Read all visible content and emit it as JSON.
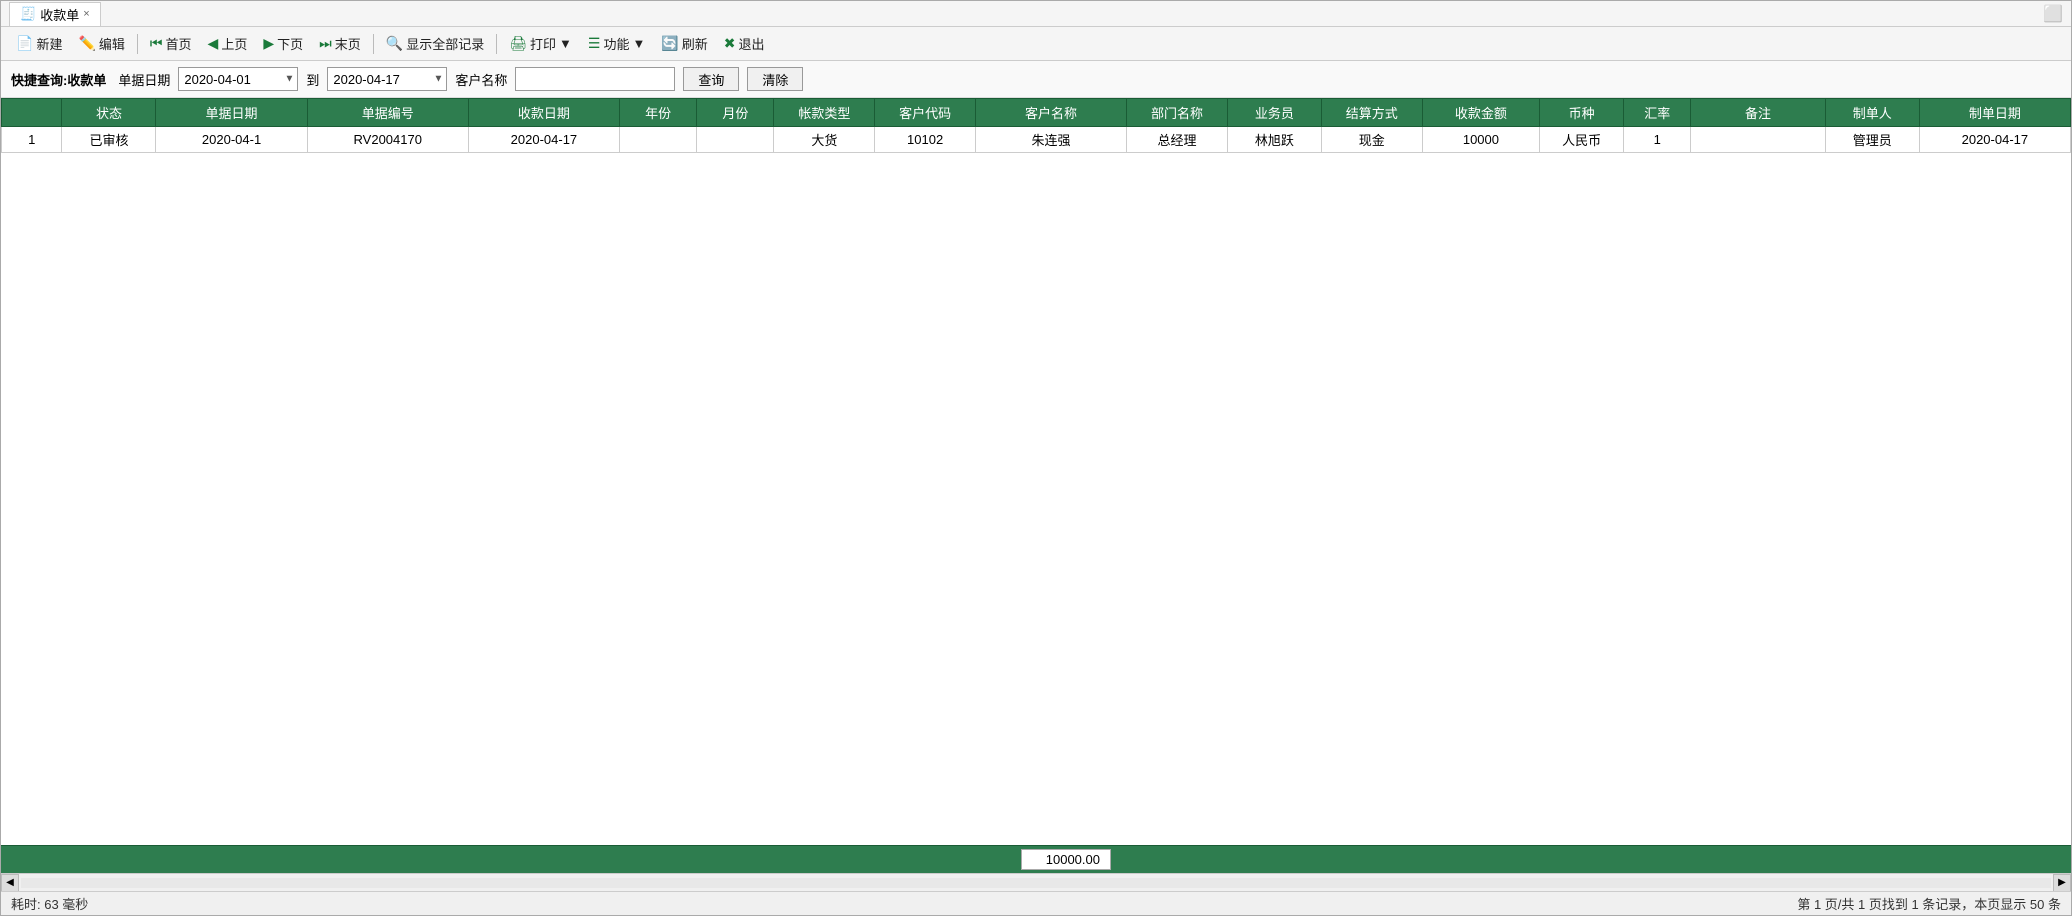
{
  "window": {
    "title": "收款单",
    "close_btn": "×"
  },
  "toolbar": {
    "new_label": "新建",
    "edit_label": "编辑",
    "first_label": "首页",
    "prev_label": "上页",
    "next_label": "下页",
    "last_label": "末页",
    "show_all_label": "显示全部记录",
    "print_label": "打印",
    "function_label": "功能",
    "refresh_label": "刷新",
    "exit_label": "退出"
  },
  "search": {
    "title": "快捷查询:收款单",
    "date_label": "单据日期",
    "date_from": "2020-04-01",
    "date_to": "2020-04-17",
    "customer_label": "客户名称",
    "customer_value": "",
    "query_btn": "查询",
    "clear_btn": "清除"
  },
  "table": {
    "columns": [
      "",
      "状态",
      "单据日期",
      "单据编号",
      "收款日期",
      "年份",
      "月份",
      "帐款类型",
      "客户代码",
      "客户名称",
      "部门名称",
      "业务员",
      "结算方式",
      "收款金额",
      "币种",
      "汇率",
      "备注",
      "制单人",
      "制单日期"
    ],
    "rows": [
      {
        "seq": "1",
        "status": "已审核",
        "date": "2020-04-1",
        "num": "RV2004170",
        "recv_date": "2020-04-17",
        "year": "",
        "month": "",
        "acct_type": "大货",
        "code": "10102",
        "name": "朱连强",
        "dept": "总经理",
        "staff": "林旭跃",
        "settle": "现金",
        "amount": "10000",
        "currency": "人民币",
        "rate": "1",
        "remark": "",
        "maker": "管理员",
        "make_date": "2020-04-17"
      }
    ]
  },
  "summary": {
    "total_amount": "10000.00"
  },
  "status_bar": {
    "time_label": "耗时: 63 毫秒",
    "page_info": "第 1 页/共 1 页找到 1 条记录，本页显示 50 条"
  }
}
